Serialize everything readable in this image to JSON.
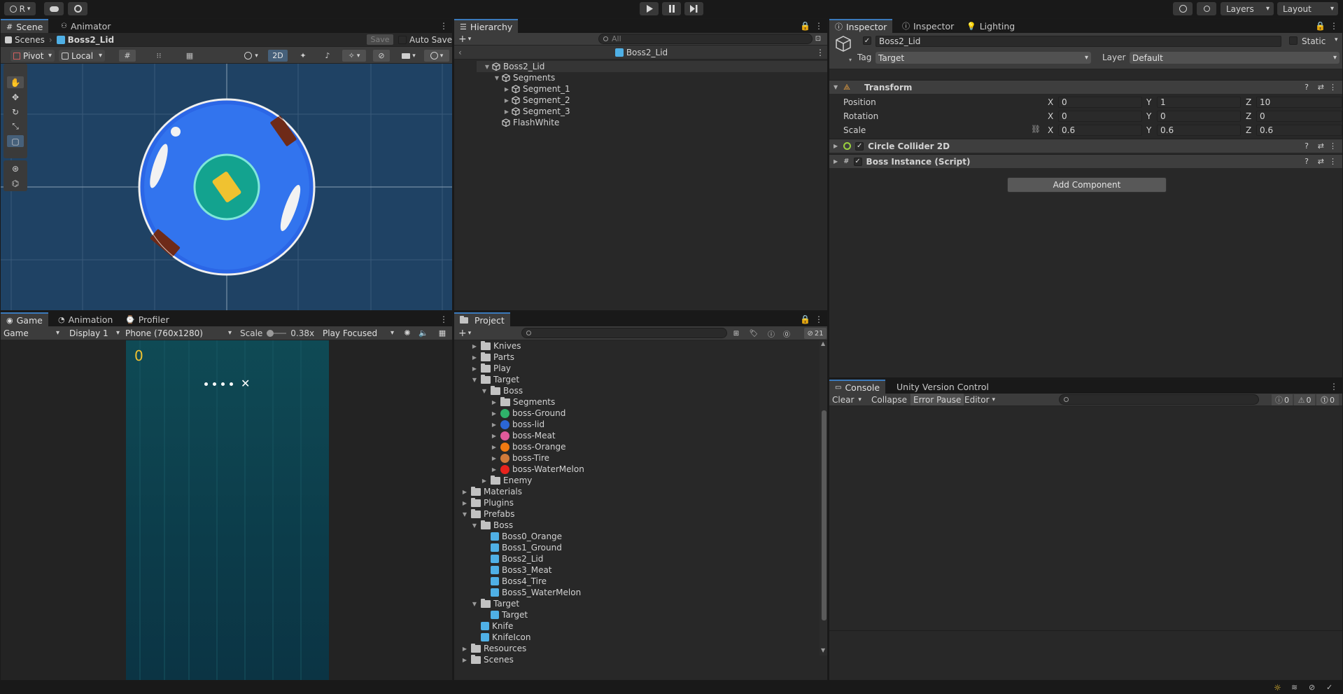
{
  "toolbar": {
    "account_label": "R",
    "layers_label": "Layers",
    "layout_label": "Layout"
  },
  "scene": {
    "tabs": [
      "Scene",
      "Animator"
    ],
    "breadcrumb_root": "Scenes",
    "breadcrumb_prefab": "Boss2_Lid",
    "save_label": "Save",
    "autosave_label": "Auto Save",
    "pivot_label": "Pivot",
    "local_label": "Local",
    "mode_2d_label": "2D"
  },
  "game": {
    "tabs": [
      "Game",
      "Animation",
      "Profiler"
    ],
    "game_dropdown": "Game",
    "display_dropdown": "Display 1",
    "resolution_dropdown": "Phone (760x1280)",
    "scale_label": "Scale",
    "scale_value": "0.38x",
    "play_mode_dropdown": "Play Focused",
    "score": "0",
    "close_glyph": "✕"
  },
  "hierarchy": {
    "tab": "Hierarchy",
    "search_placeholder": "All",
    "prefab_header": "Boss2_Lid",
    "items": [
      {
        "label": "Boss2_Lid",
        "depth": 0,
        "arrow": "▼"
      },
      {
        "label": "Segments",
        "depth": 1,
        "arrow": "▼"
      },
      {
        "label": "Segment_1",
        "depth": 2,
        "arrow": "▶"
      },
      {
        "label": "Segment_2",
        "depth": 2,
        "arrow": "▶"
      },
      {
        "label": "Segment_3",
        "depth": 2,
        "arrow": "▶"
      },
      {
        "label": "FlashWhite",
        "depth": 1,
        "arrow": ""
      }
    ]
  },
  "project": {
    "tab": "Project",
    "hidden_count": "21",
    "items": [
      {
        "label": "Knives",
        "depth": 1,
        "arrow": "▶",
        "icon": "folder"
      },
      {
        "label": "Parts",
        "depth": 1,
        "arrow": "▶",
        "icon": "folder"
      },
      {
        "label": "Play",
        "depth": 1,
        "arrow": "▶",
        "icon": "folder"
      },
      {
        "label": "Target",
        "depth": 1,
        "arrow": "▼",
        "icon": "folder-open"
      },
      {
        "label": "Boss",
        "depth": 2,
        "arrow": "▼",
        "icon": "folder-open"
      },
      {
        "label": "Segments",
        "depth": 3,
        "arrow": "▶",
        "icon": "folder"
      },
      {
        "label": "boss-Ground",
        "depth": 3,
        "arrow": "▶",
        "icon": "sprite",
        "color": "#2fb36a"
      },
      {
        "label": "boss-lid",
        "depth": 3,
        "arrow": "▶",
        "icon": "sprite",
        "color": "#2b66d6"
      },
      {
        "label": "boss-Meat",
        "depth": 3,
        "arrow": "▶",
        "icon": "sprite",
        "color": "#e05a9a"
      },
      {
        "label": "boss-Orange",
        "depth": 3,
        "arrow": "▶",
        "icon": "sprite",
        "color": "#f07a12"
      },
      {
        "label": "boss-Tire",
        "depth": 3,
        "arrow": "▶",
        "icon": "sprite",
        "color": "#d07a3a"
      },
      {
        "label": "boss-WaterMelon",
        "depth": 3,
        "arrow": "▶",
        "icon": "sprite",
        "color": "#e8231d"
      },
      {
        "label": "Enemy",
        "depth": 2,
        "arrow": "▶",
        "icon": "folder"
      },
      {
        "label": "Materials",
        "depth": 0,
        "arrow": "▶",
        "icon": "folder"
      },
      {
        "label": "Plugins",
        "depth": 0,
        "arrow": "▶",
        "icon": "folder"
      },
      {
        "label": "Prefabs",
        "depth": 0,
        "arrow": "▼",
        "icon": "folder-open"
      },
      {
        "label": "Boss",
        "depth": 1,
        "arrow": "▼",
        "icon": "folder-open"
      },
      {
        "label": "Boss0_Orange",
        "depth": 2,
        "arrow": "",
        "icon": "prefab"
      },
      {
        "label": "Boss1_Ground",
        "depth": 2,
        "arrow": "",
        "icon": "prefab"
      },
      {
        "label": "Boss2_Lid",
        "depth": 2,
        "arrow": "",
        "icon": "prefab"
      },
      {
        "label": "Boss3_Meat",
        "depth": 2,
        "arrow": "",
        "icon": "prefab"
      },
      {
        "label": "Boss4_Tire",
        "depth": 2,
        "arrow": "",
        "icon": "prefab"
      },
      {
        "label": "Boss5_WaterMelon",
        "depth": 2,
        "arrow": "",
        "icon": "prefab"
      },
      {
        "label": "Target",
        "depth": 1,
        "arrow": "▼",
        "icon": "folder-open"
      },
      {
        "label": "Target",
        "depth": 2,
        "arrow": "",
        "icon": "prefab"
      },
      {
        "label": "Knife",
        "depth": 1,
        "arrow": "",
        "icon": "prefab"
      },
      {
        "label": "KnifeIcon",
        "depth": 1,
        "arrow": "",
        "icon": "prefab"
      },
      {
        "label": "Resources",
        "depth": 0,
        "arrow": "▶",
        "icon": "folder"
      },
      {
        "label": "Scenes",
        "depth": 0,
        "arrow": "▶",
        "icon": "folder"
      }
    ]
  },
  "inspector": {
    "tabs": [
      "Inspector",
      "Inspector",
      "Lighting"
    ],
    "object_name": "Boss2_Lid",
    "static_label": "Static",
    "tag_label": "Tag",
    "tag_value": "Target",
    "layer_label": "Layer",
    "layer_value": "Default",
    "transform": {
      "title": "Transform",
      "position_label": "Position",
      "rotation_label": "Rotation",
      "scale_label": "Scale",
      "position": {
        "x": "0",
        "y": "1",
        "z": "10"
      },
      "rotation": {
        "x": "0",
        "y": "0",
        "z": "0"
      },
      "scale": {
        "x": "0.6",
        "y": "0.6",
        "z": "0.6"
      },
      "x_label": "X",
      "y_label": "Y",
      "z_label": "Z"
    },
    "components": [
      "Circle Collider 2D",
      "Boss Instance (Script)"
    ],
    "add_component_label": "Add Component"
  },
  "console": {
    "tabs": [
      "Console",
      "Unity Version Control"
    ],
    "clear_label": "Clear",
    "collapse_label": "Collapse",
    "error_pause_label": "Error Pause",
    "editor_label": "Editor",
    "info_count": "0",
    "warning_count": "0",
    "error_count": "0"
  },
  "colors": {
    "accent": "#3a79bb",
    "scene_bg": "#1f4264",
    "lid_blue": "#2b66e6",
    "lid_center": "#13a38f",
    "game_bg": "#0d3d4b"
  }
}
